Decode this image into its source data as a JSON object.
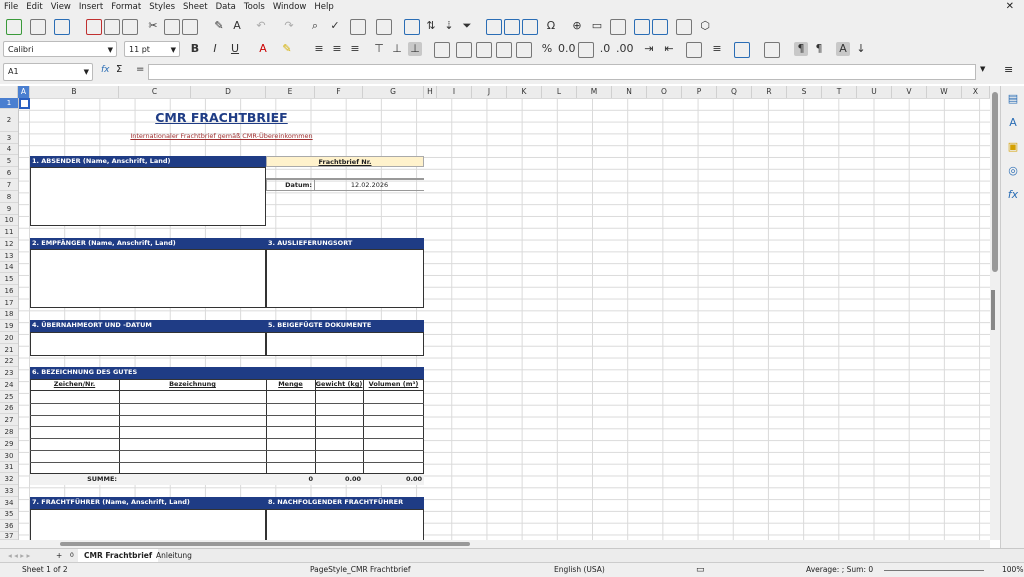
{
  "menu": [
    "File",
    "Edit",
    "View",
    "Insert",
    "Format",
    "Styles",
    "Sheet",
    "Data",
    "Tools",
    "Window",
    "Help"
  ],
  "toolbar": {
    "font_name": "Calibri",
    "font_size": "11 pt"
  },
  "formula": {
    "cell_ref": "A1",
    "fx": "fx",
    "sigma": "Σ",
    "equals": "=",
    "value": ""
  },
  "columns": [
    "A",
    "B",
    "C",
    "D",
    "E",
    "F",
    "G",
    "H",
    "I",
    "J",
    "K",
    "L",
    "M",
    "N",
    "O",
    "P",
    "Q",
    "R",
    "S",
    "T",
    "U",
    "V",
    "W",
    "X"
  ],
  "rows": [
    "1",
    "2",
    "3",
    "4",
    "5",
    "6",
    "7",
    "8",
    "9",
    "10",
    "11",
    "12",
    "13",
    "14",
    "15",
    "16",
    "17",
    "18",
    "19",
    "20",
    "21",
    "22",
    "23",
    "24",
    "25",
    "26",
    "27",
    "28",
    "29",
    "30",
    "31",
    "32",
    "33",
    "34",
    "35",
    "36",
    "37"
  ],
  "sheet": {
    "title": "CMR FRACHTBRIEF",
    "subtitle": "Internationaler Frachtbrief gemäß CMR-Übereinkommen",
    "s1": "1. ABSENDER (Name, Anschrift, Land)",
    "frachtbrief_nr": "Frachtbrief Nr.",
    "datum_label": "Datum:",
    "datum_value": "12.02.2026",
    "s2": "2. EMPFÄNGER (Name, Anschrift, Land)",
    "s3": "3. AUSLIEFERUNGSORT",
    "s4": "4. ÜBERNAHMEORT UND -DATUM",
    "s5": "5. BEIGEFÜGTE DOKUMENTE",
    "s6": "6. BEZEICHNUNG DES GUTES",
    "th": [
      "Zeichen/Nr.",
      "Bezeichnung",
      "Menge",
      "Gewicht (kg)",
      "Volumen (m³)"
    ],
    "summe": "SUMME:",
    "sum_menge": "0",
    "sum_gewicht": "0.00",
    "sum_volumen": "0.00",
    "s7": "7. FRACHTFÜHRER (Name, Anschrift, Land)",
    "s8": "8. NACHFOLGENDER FRACHTFÜHRER"
  },
  "tabs": {
    "add": "+",
    "count": "0",
    "sheet1": "CMR Frachtbrief",
    "sheet2": "Anleitung"
  },
  "status": {
    "sheet": "Sheet 1 of 2",
    "pagestyle": "PageStyle_CMR Frachtbrief",
    "language": "English (USA)",
    "sum": "Average: ; Sum: 0",
    "zoom": "100%"
  }
}
